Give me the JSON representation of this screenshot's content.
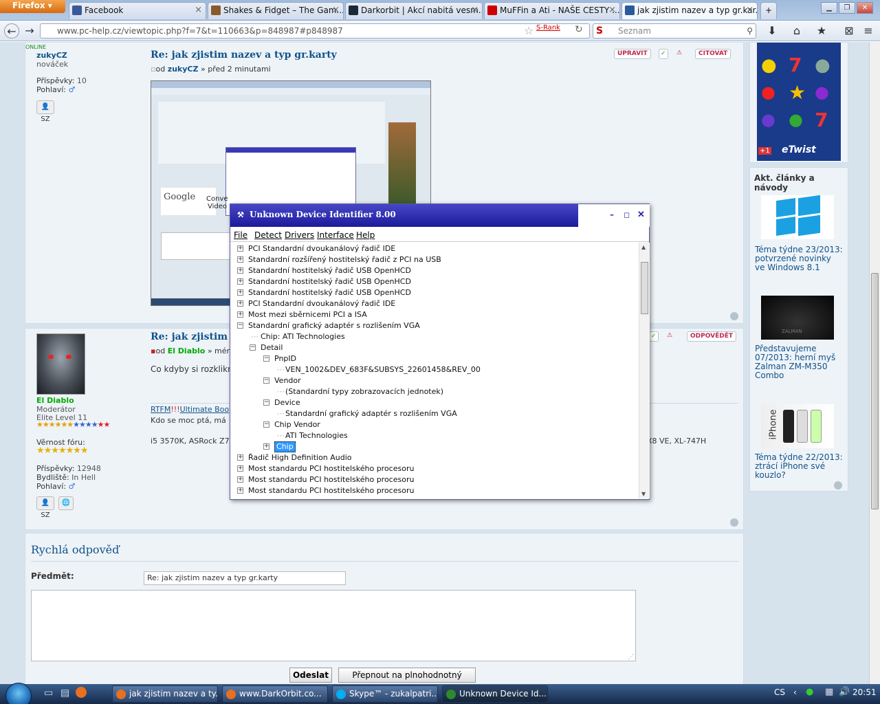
{
  "browser": {
    "app_button": "Firefox",
    "tabs": [
      {
        "label": "Facebook",
        "color": "#3b5998"
      },
      {
        "label": "Shakes & Fidget – The Gam...",
        "color": "#8a5a2a"
      },
      {
        "label": "Darkorbit | Akcí nabitá vesm...",
        "color": "#1a2a3a"
      },
      {
        "label": "MuFFin a Ati - NAŠE CESTY ...",
        "color": "#cc0000"
      },
      {
        "label": "jak zjistim nazev a typ gr.kar...",
        "color": "#2a5a9a"
      }
    ],
    "new_tab": "+",
    "url": "www.pc-help.cz/viewtopic.php?f=7&t=110663&p=848987#p848987",
    "srank": "S-Rank",
    "search_placeholder": "Seznam"
  },
  "post1": {
    "online": "ONLINE",
    "username": "zukyCZ",
    "rank": "nováček",
    "posts_label": "Příspěvky:",
    "posts_value": "10",
    "gender_label": "Pohlaví:",
    "pm_label": "SZ",
    "title": "Re: jak zjistim nazev a typ gr.karty",
    "meta_prefix": "od",
    "meta_author": "zukyCZ",
    "meta_time": "» před 2 minutami",
    "btn_edit": "UPRAVIT",
    "btn_quote": "CITOVAT"
  },
  "post2": {
    "username": "El Diablo",
    "rank": "Moderátor",
    "level": "Elite Level 11",
    "forum_label": "Věrnost fóru:",
    "posts_label": "Příspěvky:",
    "posts_value": "12948",
    "home_label": "Bydliště:",
    "home_value": "In Hell",
    "gender_label": "Pohlaví:",
    "pm_label": "SZ",
    "title": "Re: jak zjistim n",
    "meta_prefix": "od",
    "meta_author": "El Diablo",
    "meta_time": "» mén",
    "body": "Co kdyby si rozklikn",
    "sig_rtfm": "RTFM",
    "sig_bang": "!!!",
    "sig_link": "Ultimate Boo",
    "sig_line2": "Kdo se moc ptá, má",
    "sig_line3": "i5 3570K, ASRock Z7",
    "sig_line3_right": "X8 VE, XL-747H",
    "btn_reply": "ODPOVĚDĚT"
  },
  "sidebar": {
    "ad_brand": "eTwist",
    "ad_plus": "+1",
    "articles_heading": "Akt. články a návody",
    "articles": [
      {
        "title": "Téma týdne 23/2013: potvrzené novinky ve Windows 8.1"
      },
      {
        "title": "Představujeme 07/2013: herní myš Zalman ZM-M350 Combo"
      },
      {
        "title": "Téma týdne 22/2013: ztrácí iPhone své kouzlo?"
      }
    ],
    "mouse_brand": "ZALMAN",
    "iphone_label": "iPhone"
  },
  "quick_reply": {
    "heading": "Rychlá odpověď",
    "subject_label": "Předmět:",
    "subject_value": "Re: jak zjistim nazev a typ gr.karty",
    "submit": "Odeslat",
    "full_editor": "Přepnout na plnohodnotný editor"
  },
  "thumbnail": {
    "google": "Google",
    "conv": "Conve",
    "video": "Video"
  },
  "dialog": {
    "title": "Unknown Device Identifier 8.00",
    "menu": [
      "File",
      "Detect",
      "Drivers",
      "Interface",
      "Help"
    ],
    "tree": [
      {
        "label": "PCI Standardní dvoukanálový řadič IDE",
        "level": 0,
        "toggle": "+"
      },
      {
        "label": "Standardní rozšířený hostitelský řadič z PCI na USB",
        "level": 0,
        "toggle": "+"
      },
      {
        "label": "Standardní hostitelský řadič  USB OpenHCD",
        "level": 0,
        "toggle": "+"
      },
      {
        "label": "Standardní hostitelský řadič  USB OpenHCD",
        "level": 0,
        "toggle": "+"
      },
      {
        "label": "Standardní hostitelský řadič  USB OpenHCD",
        "level": 0,
        "toggle": "+"
      },
      {
        "label": "PCI Standardní dvoukanálový řadič IDE",
        "level": 0,
        "toggle": "+"
      },
      {
        "label": "Most mezi sběrnicemi PCI a ISA",
        "level": 0,
        "toggle": "+"
      },
      {
        "label": "Standardní grafický adaptér s rozlišením VGA",
        "level": 0,
        "toggle": "-"
      },
      {
        "label": "Chip: ATI Technologies",
        "level": 1,
        "toggle": ""
      },
      {
        "label": "Detail",
        "level": 1,
        "toggle": "-"
      },
      {
        "label": "PnpID",
        "level": 2,
        "toggle": "-"
      },
      {
        "label": "VEN_1002&DEV_683F&SUBSYS_22601458&REV_00",
        "level": 3,
        "toggle": ""
      },
      {
        "label": "Vendor",
        "level": 2,
        "toggle": "-"
      },
      {
        "label": "(Standardní typy zobrazovacích jednotek)",
        "level": 3,
        "toggle": ""
      },
      {
        "label": "Device",
        "level": 2,
        "toggle": "-"
      },
      {
        "label": "Standardní grafický adaptér s rozlišením VGA",
        "level": 3,
        "toggle": ""
      },
      {
        "label": "Chip Vendor",
        "level": 2,
        "toggle": "-"
      },
      {
        "label": "ATI Technologies",
        "level": 3,
        "toggle": ""
      },
      {
        "label": "Chip",
        "level": 2,
        "toggle": "+",
        "selected": true
      },
      {
        "label": "Řadič High Definition Audio",
        "level": 0,
        "toggle": "+"
      },
      {
        "label": "Most standardu PCI hostitelského procesoru",
        "level": 0,
        "toggle": "+"
      },
      {
        "label": "Most standardu PCI hostitelského procesoru",
        "level": 0,
        "toggle": "+"
      },
      {
        "label": "Most standardu PCI hostitelského procesoru",
        "level": 0,
        "toggle": "+"
      }
    ]
  },
  "taskbar": {
    "items": [
      {
        "label": "jak zjistim nazev a ty...",
        "color": "#e87020",
        "active": false
      },
      {
        "label": "www.DarkOrbit.co...",
        "color": "#e87020",
        "active": false
      },
      {
        "label": "Skype™ - zukalpatri...",
        "color": "#00aff0",
        "active": false
      },
      {
        "label": "Unknown Device Id...",
        "color": "#2d8a2d",
        "active": true
      }
    ],
    "lang": "CS",
    "clock": "20:51"
  },
  "colors": {
    "forum_link": "#105289",
    "forum_bg": "#d7e3ec",
    "post_bg": "#eef3f8",
    "dialog_title": "#1b1b9a",
    "tree_selected": "#3399ff",
    "username_green": "#00aa00"
  }
}
